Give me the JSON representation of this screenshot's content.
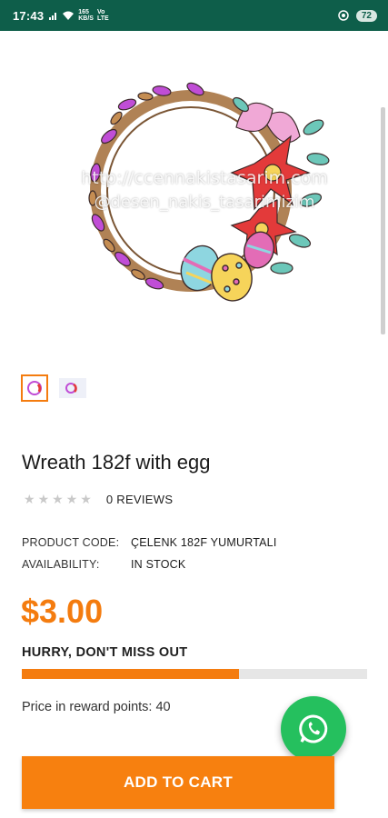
{
  "status_bar": {
    "time": "17:43",
    "network_top": "165",
    "network_unit": "KB/S",
    "network_type": "LTE",
    "battery": "72"
  },
  "product": {
    "image": {
      "icon": "wreath-with-eggs-image",
      "watermark_line1": "http://ccennakistasarim.com",
      "watermark_line2": "@desen_nakis_tasarimizim"
    },
    "thumbnails": [
      "wreath-thumbnail",
      "wreath-thumbnail-alt"
    ],
    "title": "Wreath 182f with egg",
    "rating": {
      "stars_filled": 0,
      "stars_total": 5,
      "reviews": "0 REVIEWS"
    },
    "specs": [
      {
        "label": "PRODUCT CODE:",
        "value": "ÇELENK 182F YUMURTALI"
      },
      {
        "label": "AVAILABILITY:",
        "value": "IN STOCK"
      }
    ],
    "price": "$3.00",
    "urgency": "HURRY, DON'T MISS OUT",
    "stock_progress": 0.63,
    "reward_points": "Price in reward points: 40",
    "add_to_cart": "ADD TO CART"
  },
  "colors": {
    "accent": "#f47c0f",
    "status_bar": "#0e5e4a",
    "whatsapp": "#25c05e"
  }
}
